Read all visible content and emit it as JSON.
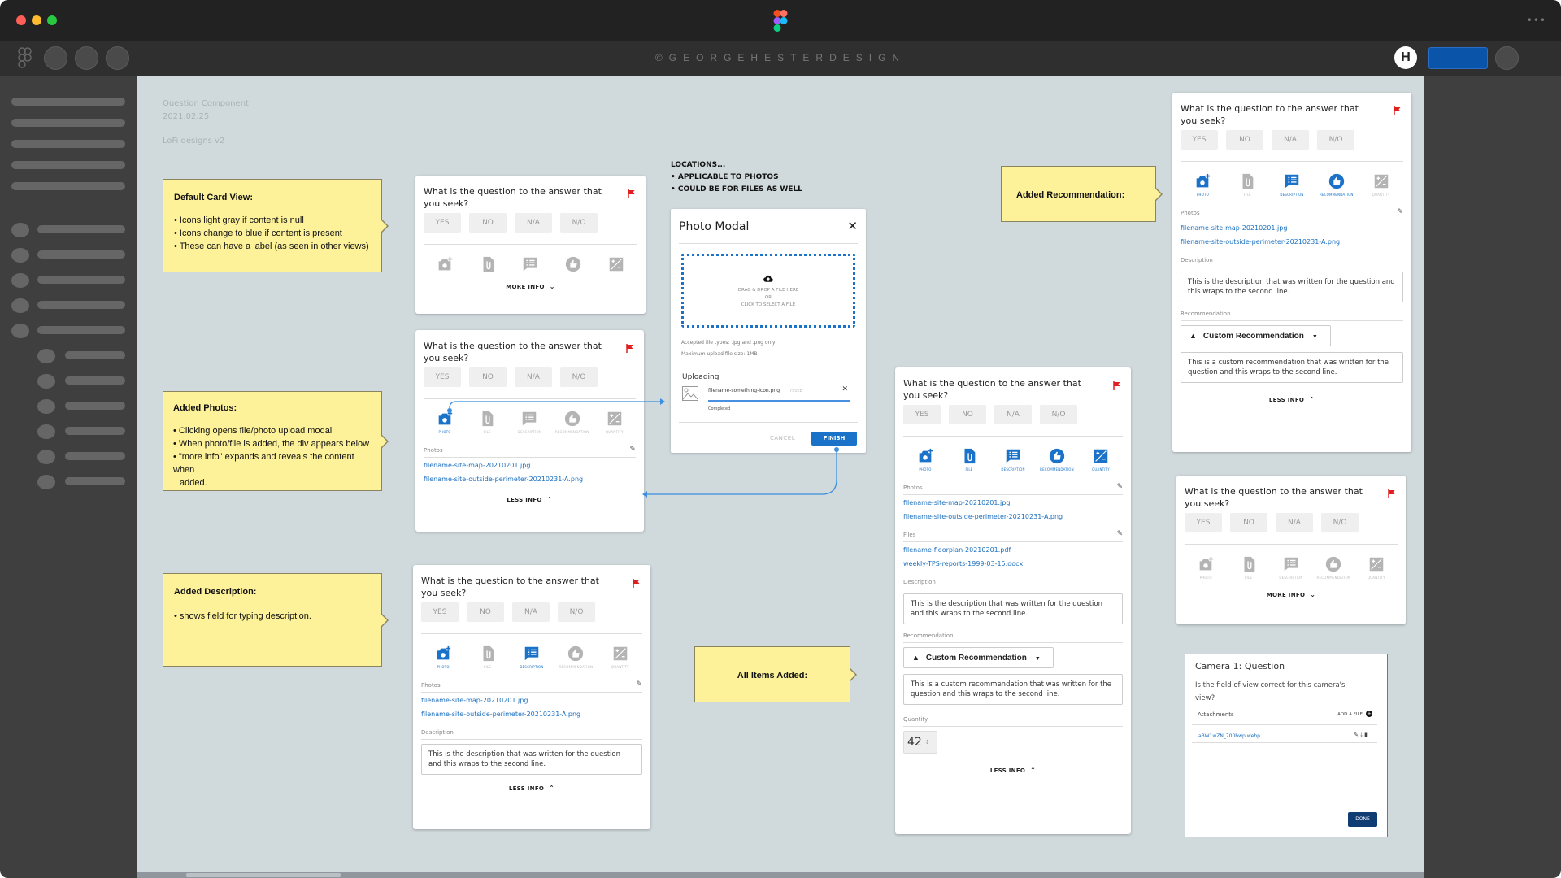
{
  "window": {
    "traffic_lights": {
      "close": "#ff5f57",
      "minimize": "#febc2e",
      "zoom": "#28c840"
    }
  },
  "toolbar": {
    "title": "©GEORGEHESTERDESIGN",
    "brand_logo": "H",
    "share_color": "#0a55a9"
  },
  "canvas_meta": {
    "line1": "Question Component",
    "line2": "2021.02.25",
    "line3": "LoFi designs v2"
  },
  "colors": {
    "accent": "#1a73c8",
    "flag": "#e02020",
    "note_bg": "#fdf29a",
    "canvas_bg": "#d0d9dc"
  },
  "notes": {
    "default": {
      "title": "Default Card View:",
      "items": [
        "• Icons light gray if content is null",
        "• Icons change to blue if content is present",
        "• These can have a label (as seen in other views)"
      ]
    },
    "photos": {
      "title": "Added Photos:",
      "items": [
        "• Clicking opens file/photo upload modal",
        "• When photo/file is added, the div appears below",
        "• \"more info\" expands and reveals the content when",
        "   added."
      ]
    },
    "description": {
      "title": "Added Description:",
      "items": [
        "• shows field for typing description."
      ]
    },
    "all_items": {
      "title": "All Items Added:"
    },
    "recommendation": {
      "title": "Added Recommendation:"
    }
  },
  "locations_note": {
    "l1": "LOCATIONS...",
    "l2": "• APPLICABLE TO PHOTOS",
    "l3": "• COULD BE FOR FILES AS WELL"
  },
  "card": {
    "question": "What is the question to the answer that you seek?",
    "answers": [
      "YES",
      "NO",
      "N/A",
      "N/O"
    ],
    "icon_labels": [
      "PHOTO",
      "FILE",
      "DESCRIPTION",
      "RECOMMENDATION",
      "QUANTITY"
    ],
    "more_info": "MORE INFO",
    "less_info": "LESS INFO",
    "photos_label": "Photos",
    "files_label": "Files",
    "description_label": "Description",
    "recommendation_label": "Recommendation",
    "quantity_label": "Quantity",
    "photo_files": [
      "filename-site-map-20210201.jpg",
      "filename-site-outside-perimeter-20210231-A.png"
    ],
    "other_files": [
      "filename-floorplan-20210201.pdf",
      "weekly-TPS-reports-1999-03-15.docx"
    ],
    "description_text": "This is the description that was written for the question and this wraps to the second line.",
    "recommendation_select": "Custom Recommendation",
    "recommendation_text": "This is a custom recommendation that was written for the question and this wraps to the second line.",
    "quantity_value": "42"
  },
  "modal": {
    "title": "Photo Modal",
    "drop_l1": "DRAG & DROP A FILE HERE",
    "drop_l2": "OR",
    "drop_l3": "CLICK TO SELECT A FILE",
    "accepted": "Accepted file types: .jpg and .png only",
    "max_size": "Maximum upload file size: 1MB",
    "uploading": "Uploading",
    "file_name": "filename-something-icon.png",
    "file_size": "750kb",
    "status": "Completed",
    "progress": 1.0,
    "cancel": "CANCEL",
    "finish": "FINISH"
  },
  "camera_dialog": {
    "title": "Camera 1: Question",
    "question": "Is the field of view correct for this camera's view?",
    "attachments_label": "Attachments",
    "add_file": "ADD A FILE",
    "file": "aBW1wZN_700bwp.webp",
    "done": "DONE"
  }
}
